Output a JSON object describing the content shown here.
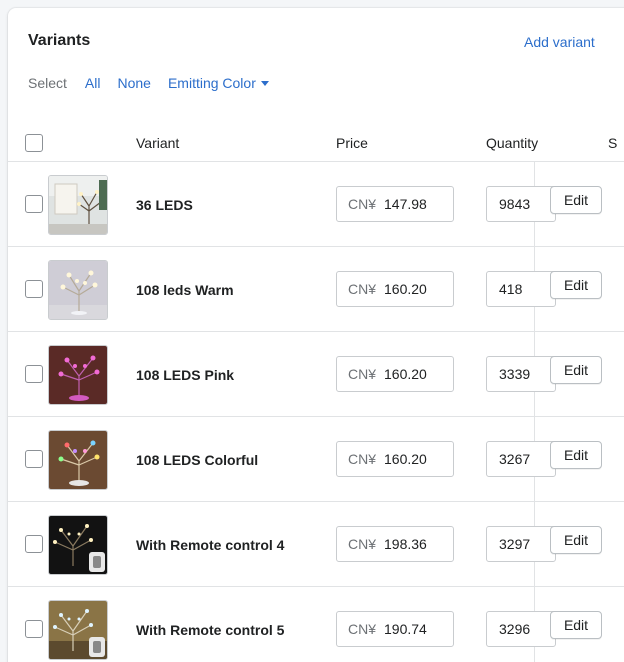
{
  "card": {
    "title": "Variants",
    "add_variant": "Add variant"
  },
  "select": {
    "label": "Select",
    "all": "All",
    "none": "None",
    "filter": "Emitting Color"
  },
  "columns": {
    "variant": "Variant",
    "price": "Price",
    "quantity": "Quantity",
    "sku": "S"
  },
  "rows": [
    {
      "name": "36 LEDS",
      "currency": "CN¥",
      "price": "147.98",
      "quantity": "9843",
      "edit": "Edit"
    },
    {
      "name": "108 leds Warm",
      "currency": "CN¥",
      "price": "160.20",
      "quantity": "418",
      "edit": "Edit"
    },
    {
      "name": "108 LEDS Pink",
      "currency": "CN¥",
      "price": "160.20",
      "quantity": "3339",
      "edit": "Edit"
    },
    {
      "name": "108 LEDS Colorful",
      "currency": "CN¥",
      "price": "160.20",
      "quantity": "3267",
      "edit": "Edit"
    },
    {
      "name": "With Remote control 4",
      "currency": "CN¥",
      "price": "198.36",
      "quantity": "3297",
      "edit": "Edit"
    },
    {
      "name": "With Remote control 5",
      "currency": "CN¥",
      "price": "190.74",
      "quantity": "3296",
      "edit": "Edit"
    }
  ],
  "colors": {
    "link": "#2c6ecb",
    "border": "#e1e3e5",
    "text": "#202223",
    "muted": "#6d7175"
  }
}
